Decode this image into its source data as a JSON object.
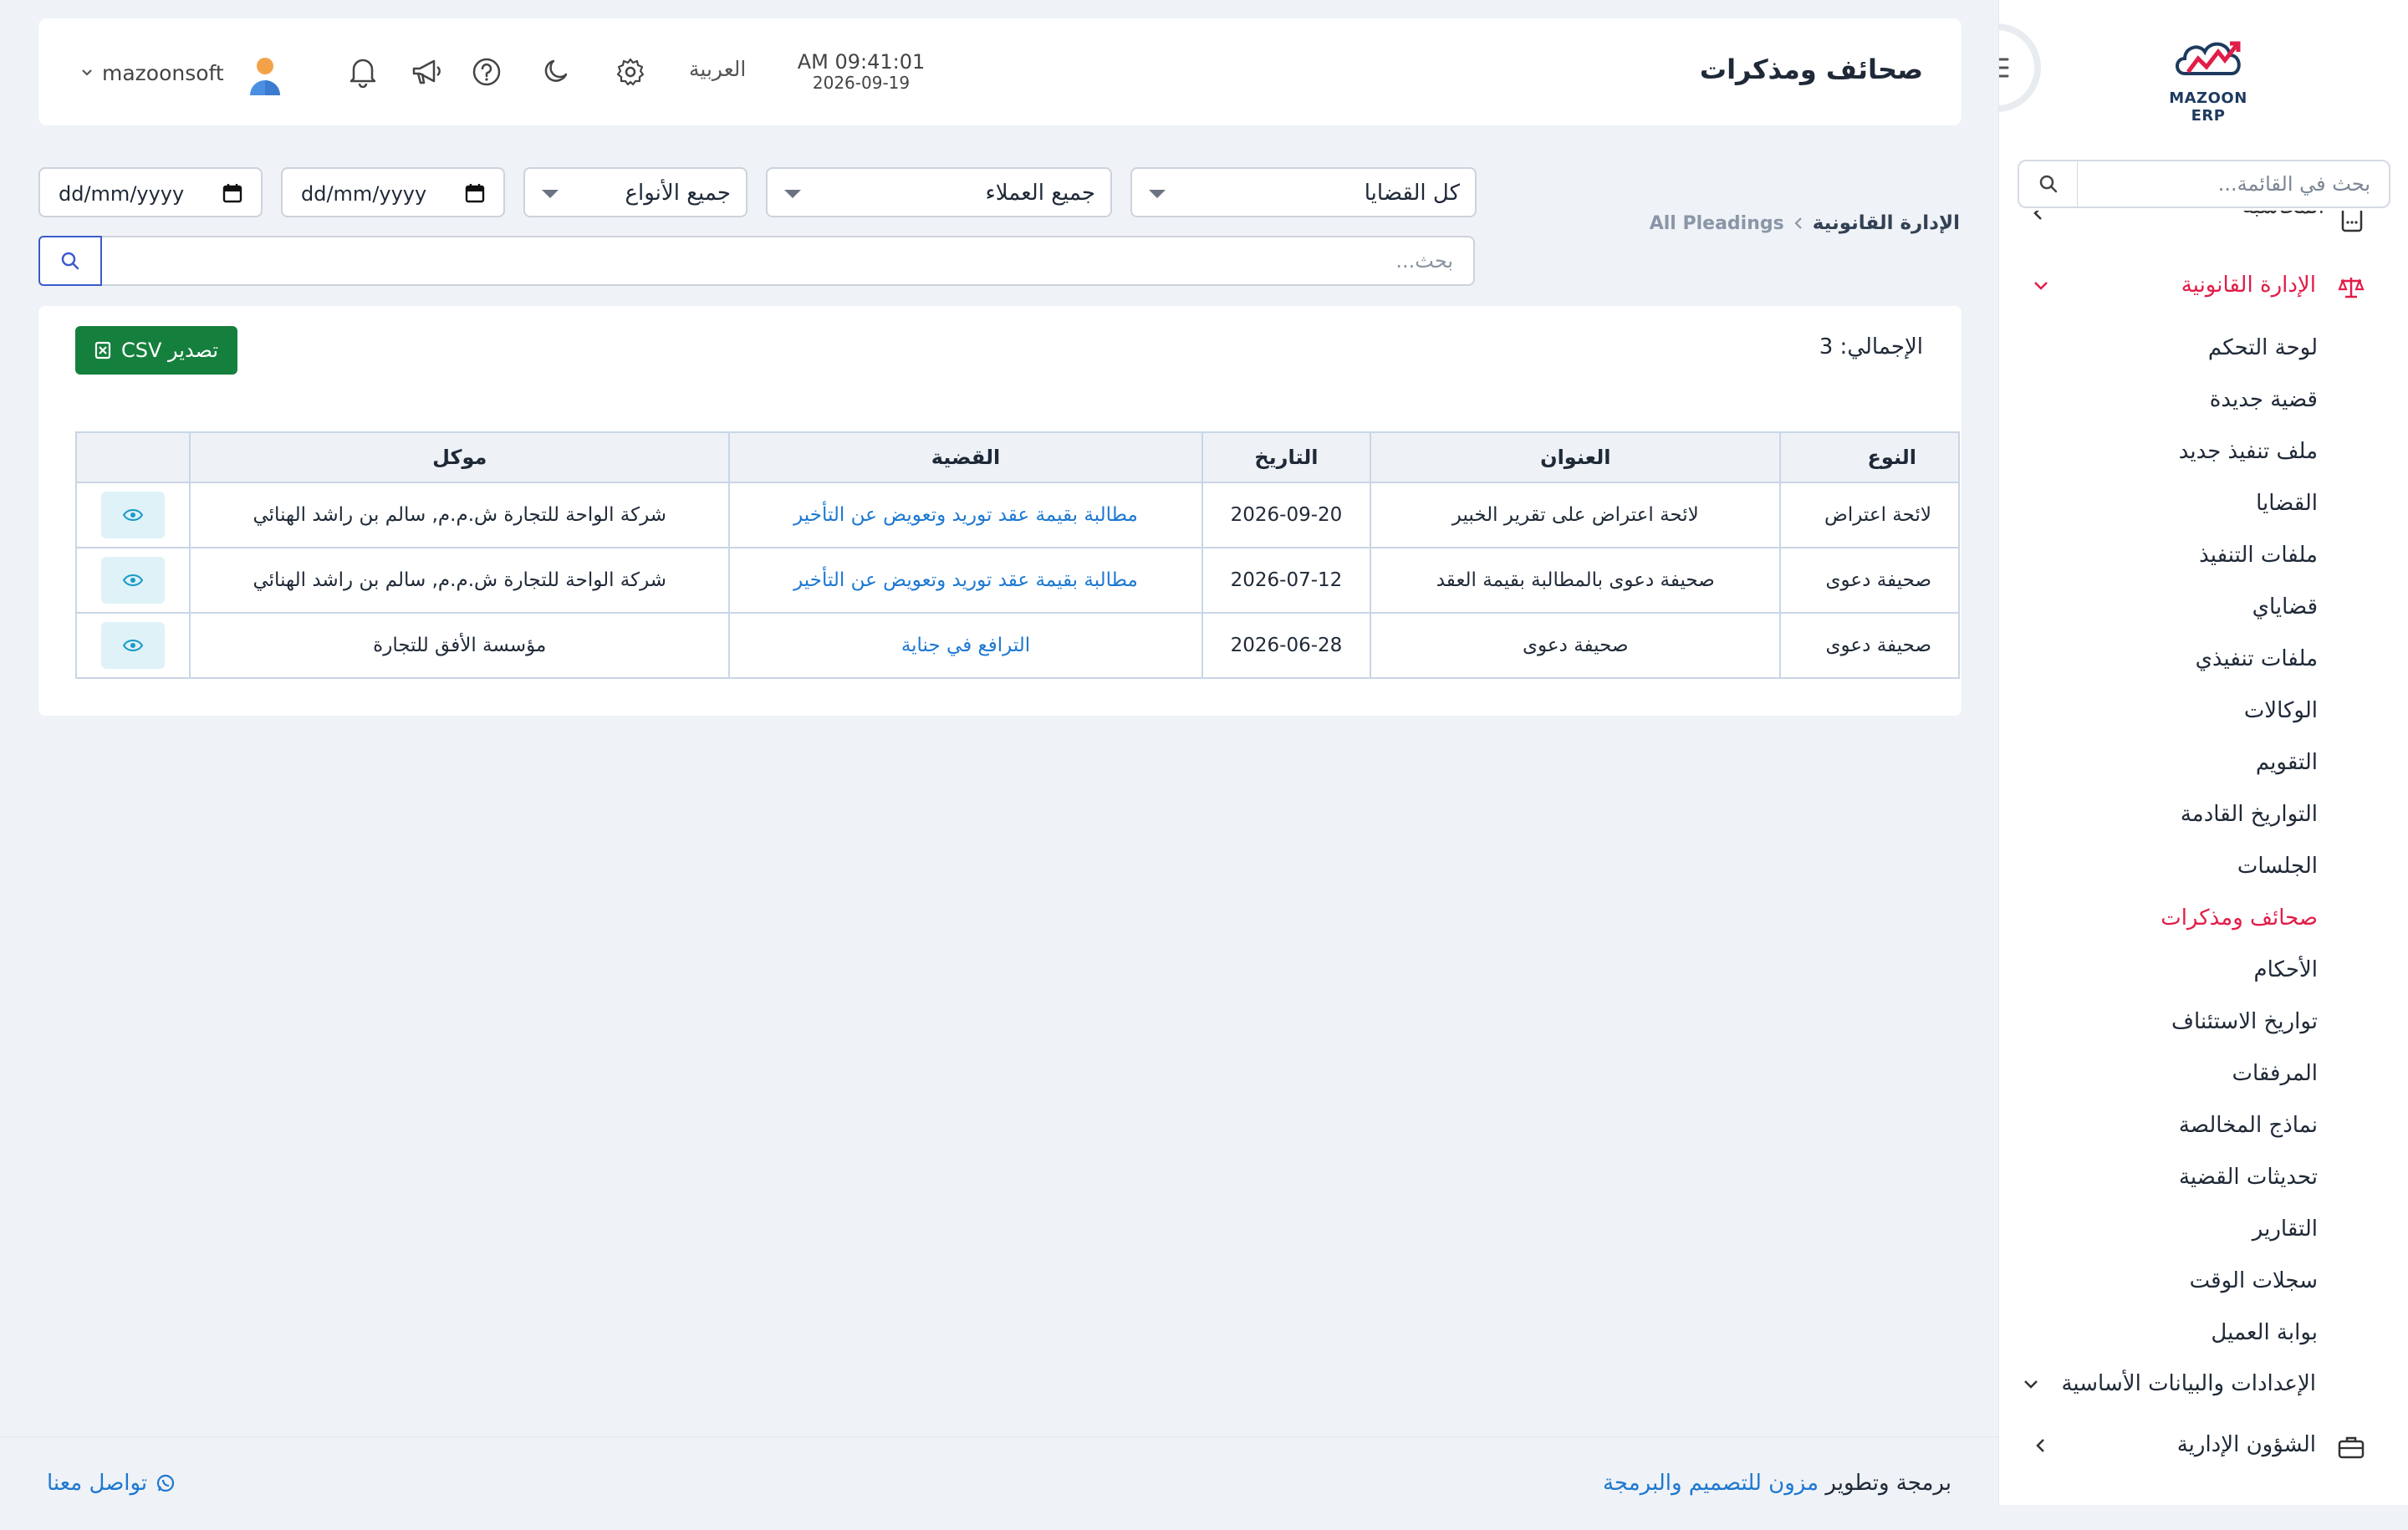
{
  "app": {
    "logo_text": "MAZOON ERP",
    "accent_color": "#e11d48",
    "link_color": "#1d78d1"
  },
  "header": {
    "title": "صحائف ومذكرات",
    "time": "AM 09:41:01",
    "date": "2026-09-19",
    "language": "العربية",
    "user_name": "mazoonsoft"
  },
  "sidebar": {
    "search_placeholder": "بحث في القائمة...",
    "top_partial_item": "المحاسبة",
    "legal_section": "الإدارة القانونية",
    "legal_items": [
      "لوحة التحكم",
      "قضية جديدة",
      "ملف تنفيذ جديد",
      "القضايا",
      "ملفات التنفيذ",
      "قضاياي",
      "ملفات تنفيذي",
      "الوكالات",
      "التقويم",
      "التواريخ القادمة",
      "الجلسات",
      "صحائف ومذكرات",
      "الأحكام",
      "تواريخ الاستئناف",
      "المرفقات",
      "نماذج المخالصة",
      "تحديثات القضية",
      "التقارير",
      "سجلات الوقت",
      "بوابة العميل"
    ],
    "active_item": "صحائف ومذكرات",
    "settings_section": "الإعدادات والبيانات الأساسية",
    "admin_section": "الشؤون الإدارية"
  },
  "breadcrumb": {
    "parent": "الإدارة القانونية",
    "current": "All Pleadings"
  },
  "filters": {
    "cases": "كل القضايا",
    "clients": "جميع العملاء",
    "types": "جميع الأنواع",
    "date_to": "dd/mm/yyyy",
    "date_from": "dd/mm/yyyy",
    "search_placeholder": "بحث..."
  },
  "summary": {
    "total_label": "الإجمالي: 3",
    "export_label": "تصدير CSV"
  },
  "table": {
    "columns": [
      "النوع",
      "العنوان",
      "التاريخ",
      "القضية",
      "موكل",
      ""
    ],
    "rows": [
      {
        "type": "لائحة اعتراض",
        "title": "لائحة اعتراض على تقرير الخبير",
        "date": "2026-09-20",
        "case": "مطالبة بقيمة عقد توريد وتعويض عن التأخير",
        "client": "شركة الواحة للتجارة ش.م.م, سالم بن راشد الهنائي"
      },
      {
        "type": "صحيفة دعوى",
        "title": "صحيفة دعوى بالمطالبة بقيمة العقد",
        "date": "2026-07-12",
        "case": "مطالبة بقيمة عقد توريد وتعويض عن التأخير",
        "client": "شركة الواحة للتجارة ش.م.م, سالم بن راشد الهنائي"
      },
      {
        "type": "صحيفة دعوى",
        "title": "صحيفة دعوى",
        "date": "2026-06-28",
        "case": "الترافع في جناية",
        "client": "مؤسسة الأفق للتجارة"
      }
    ]
  },
  "footer": {
    "credit_prefix": "برمجة وتطوير",
    "credit_brand": "مزون للتصميم والبرمجة",
    "contact": "تواصل معنا"
  }
}
